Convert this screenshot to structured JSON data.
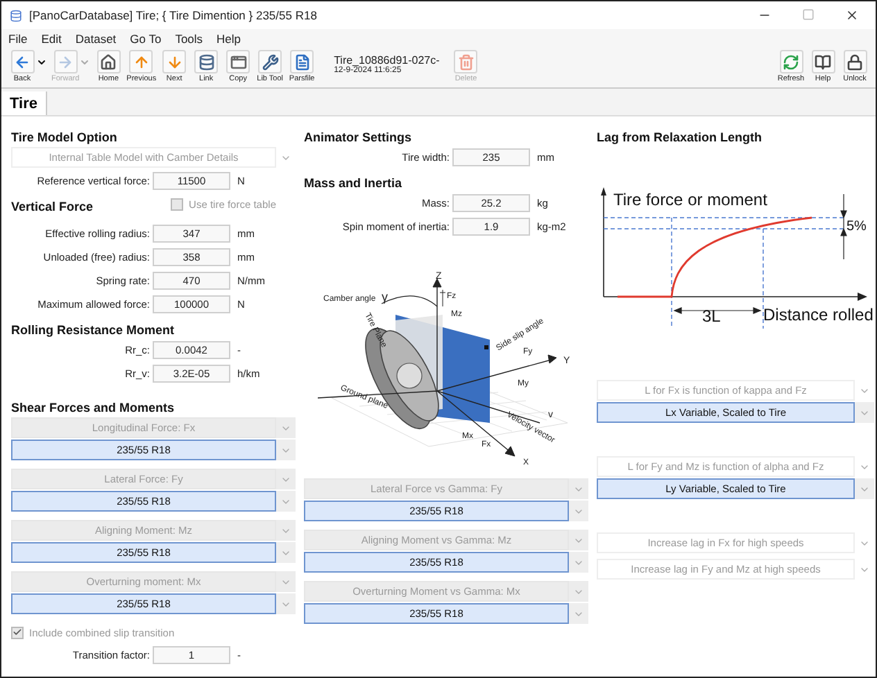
{
  "window": {
    "title": "[PanoCarDatabase] Tire; { Tire Dimention } 235/55 R18"
  },
  "menu": [
    "File",
    "Edit",
    "Dataset",
    "Go To",
    "Tools",
    "Help"
  ],
  "toolbar": {
    "buttons": [
      {
        "label": "Back",
        "disabled": false,
        "dropdown": true
      },
      {
        "label": "Forward",
        "disabled": true,
        "dropdown": true
      },
      {
        "label": "Home",
        "disabled": false,
        "dropdown": false
      },
      {
        "label": "Previous",
        "disabled": false,
        "dropdown": false
      },
      {
        "label": "Next",
        "disabled": false,
        "dropdown": false
      },
      {
        "label": "Link",
        "disabled": false,
        "dropdown": false
      },
      {
        "label": "Copy",
        "disabled": false,
        "dropdown": false
      },
      {
        "label": "Lib Tool",
        "disabled": false,
        "dropdown": false
      },
      {
        "label": "Parsfile",
        "disabled": false,
        "dropdown": false
      }
    ],
    "dataset": {
      "name": "Tire_10886d91-027c-",
      "date": "12-9-2024 11:6:25"
    },
    "delete": {
      "label": "Delete",
      "disabled": true
    },
    "right_buttons": [
      {
        "label": "Refresh"
      },
      {
        "label": "Help"
      },
      {
        "label": "Unlock"
      }
    ]
  },
  "tabs": [
    {
      "label": "Tire",
      "selected": true
    }
  ],
  "tire_model": {
    "heading": "Tire Model Option",
    "model": {
      "value": "Internal Table Model with Camber Details",
      "disabled": true
    },
    "fields": [
      {
        "label": "Reference vertical force:",
        "value": "11500",
        "unit": "N"
      }
    ]
  },
  "vertical_force": {
    "heading": "Vertical Force",
    "use_table": {
      "label": "Use tire force table",
      "checked": false,
      "disabled": true
    },
    "fields": [
      {
        "label": "Effective rolling radius:",
        "value": "347",
        "unit": "mm"
      },
      {
        "label": "Unloaded (free) radius:",
        "value": "358",
        "unit": "mm"
      },
      {
        "label": "Spring rate:",
        "value": "470",
        "unit": "N/mm"
      },
      {
        "label": "Maximum allowed force:",
        "value": "100000",
        "unit": "N"
      }
    ]
  },
  "rolling_resistance": {
    "heading": "Rolling Resistance Moment",
    "fields": [
      {
        "label": "Rr_c:",
        "value": "0.0042",
        "unit": "-"
      },
      {
        "label": "Rr_v:",
        "value": "3.2E-05",
        "unit": "h/km"
      }
    ]
  },
  "shear": {
    "heading": "Shear Forces and Moments",
    "selectors": [
      {
        "label": "Longitudinal Force: Fx",
        "value": "235/55 R18"
      },
      {
        "label": "Lateral Force: Fy",
        "value": "235/55 R18"
      },
      {
        "label": "Aligning Moment: Mz",
        "value": "235/55 R18"
      },
      {
        "label": "Overturning moment: Mx",
        "value": "235/55 R18"
      }
    ],
    "combined": {
      "label": "Include combined slip transition",
      "checked": true,
      "disabled": true
    },
    "transition": {
      "label": "Transition factor:",
      "value": "1",
      "unit": "-"
    }
  },
  "animator": {
    "heading": "Animator Settings",
    "fields": [
      {
        "label": "Tire width:",
        "value": "235",
        "unit": "mm"
      }
    ]
  },
  "mass": {
    "heading": "Mass and Inertia",
    "fields": [
      {
        "label": "Mass:",
        "value": "25.2",
        "unit": "kg"
      },
      {
        "label": "Spin moment of inertia:",
        "value": "1.9",
        "unit": "kg-m2"
      }
    ]
  },
  "diagram": {
    "labels": [
      "Camber angle",
      "γ",
      "Z",
      "Fz",
      "Mz",
      "Tire Plane",
      "Side slip angle",
      "Fy",
      "Y",
      "My",
      "Ground plane",
      "v",
      "Velocity vector",
      "Mx",
      "Fx",
      "X"
    ]
  },
  "gamma_selectors": [
    {
      "label": "Lateral Force vs Gamma: Fy",
      "value": "235/55 R18"
    },
    {
      "label": "Aligning Moment vs Gamma: Mz",
      "value": "235/55 R18"
    },
    {
      "label": "Overturning Moment vs Gamma: Mx",
      "value": "235/55 R18"
    }
  ],
  "lag": {
    "heading": "Lag from Relaxation Length",
    "chart_labels": [
      "Tire force or moment",
      "5%",
      "3L",
      "Distance rolled"
    ],
    "selectors": [
      {
        "label": "L for Fx is function of kappa and Fz",
        "value": "Lx Variable, Scaled to Tire"
      },
      {
        "label": "L for Fy and Mz is function of alpha and Fz",
        "value": "Ly Variable, Scaled to Tire"
      }
    ],
    "options": [
      "Increase lag in Fx for high speeds",
      "Increase lag in Fy and Mz at high speeds"
    ]
  }
}
